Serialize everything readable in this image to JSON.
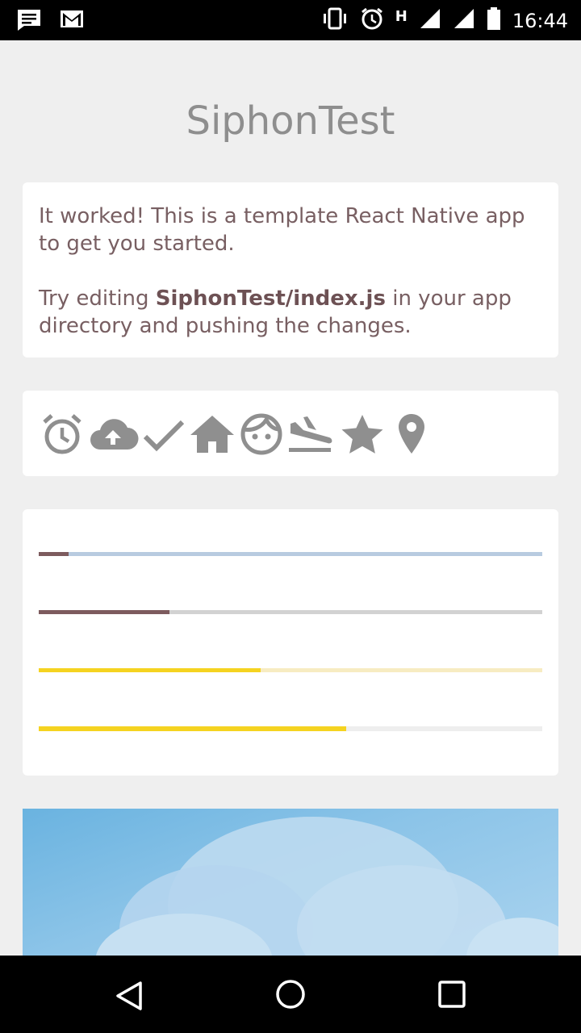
{
  "status_bar": {
    "time": "16:44",
    "network_label": "H",
    "left_icons": [
      "message-icon",
      "gmail-icon"
    ],
    "right_icons": [
      "vibrate-icon",
      "alarm-icon",
      "signal-icon",
      "signal-icon",
      "battery-icon"
    ]
  },
  "app": {
    "title": "SiphonTest"
  },
  "intro_card": {
    "line1": "It worked! This is a template React Native app to get you started.",
    "line2_prefix": "Try editing ",
    "line2_bold": "SiphonTest/index.js",
    "line2_suffix": " in your app directory and pushing the changes."
  },
  "icons_row": [
    "alarm-icon",
    "cloud-upload-icon",
    "check-icon",
    "home-icon",
    "face-icon",
    "flight-land-icon",
    "star-icon",
    "location-pin-icon"
  ],
  "progress_bars": [
    {
      "value": 0.06,
      "fill_color": "#7d5b5e",
      "track_color": "#b8cbe0"
    },
    {
      "value": 0.26,
      "fill_color": "#7d5b5e",
      "track_color": "#d2d2d2"
    },
    {
      "value": 0.44,
      "fill_color": "#f5d320",
      "track_color": "#f7ecc2"
    },
    {
      "value": 0.61,
      "fill_color": "#f5d320",
      "track_color": "#eeeeee"
    }
  ],
  "colors": {
    "background": "#efefef",
    "text": "#785f62",
    "icon_gray": "#8f8f8f",
    "accent_yellow": "#f5d320"
  },
  "nav_bar": [
    "back-icon",
    "home-circle-icon",
    "recents-icon"
  ]
}
